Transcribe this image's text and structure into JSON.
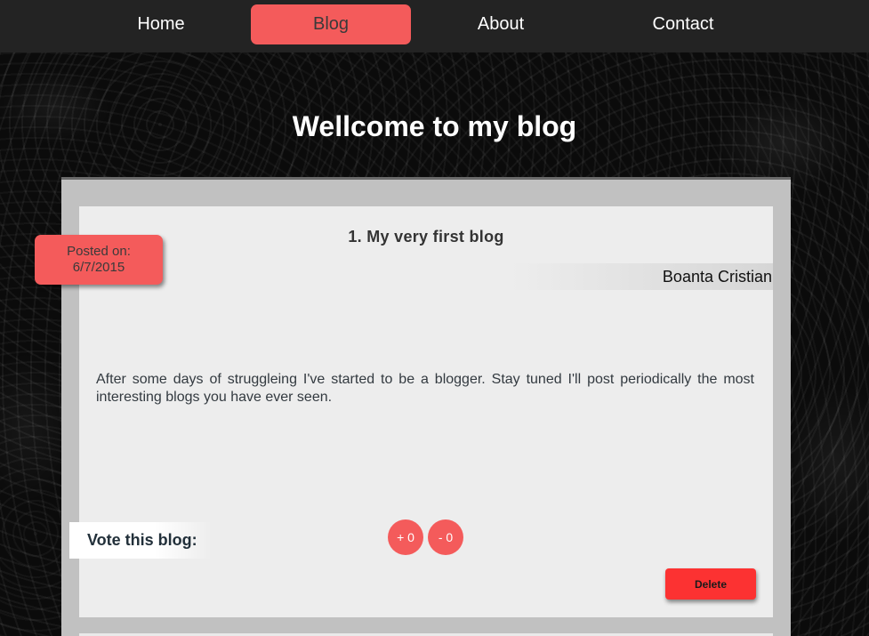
{
  "nav": {
    "items": [
      {
        "label": "Home"
      },
      {
        "label": "Blog"
      },
      {
        "label": "About"
      },
      {
        "label": "Contact"
      }
    ],
    "active": "Blog"
  },
  "page": {
    "title": "Wellcome to my blog"
  },
  "post": {
    "title": "1. My very first blog",
    "author": "Boanta Cristian",
    "posted_label": "Posted on:",
    "date": "6/7/2015",
    "body": "After some days of struggleing I've started to be a blogger. Stay tuned I'll post periodically the most interesting blogs you have ever seen.",
    "vote_label": "Vote this blog:",
    "upvote_label": "+ 0",
    "downvote_label": "- 0",
    "delete_label": "Delete"
  },
  "colors": {
    "accent": "#f45b5b",
    "delete": "#fc3232",
    "navbar": "#232323",
    "card": "#ededed",
    "frame": "#c1c1c1"
  }
}
